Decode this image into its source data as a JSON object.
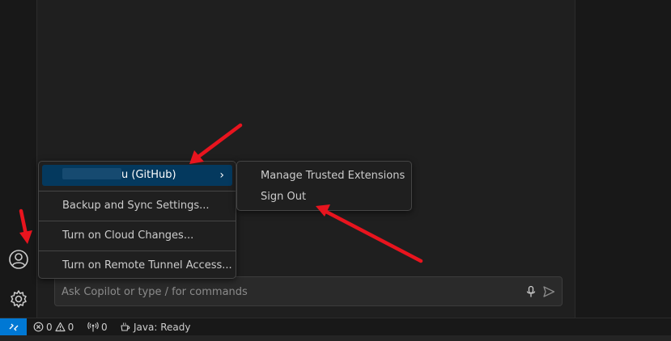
{
  "chat": {
    "placeholder": "Ask Copilot or type / for commands"
  },
  "accounts_menu": {
    "account_suffix": "u (GitHub)",
    "items": [
      "Backup and Sync Settings...",
      "Turn on Cloud Changes...",
      "Turn on Remote Tunnel Access..."
    ]
  },
  "account_submenu": {
    "items": [
      "Manage Trusted Extensions",
      "Sign Out"
    ]
  },
  "status_bar": {
    "errors": "0",
    "warnings": "0",
    "ports": "0",
    "java": "Java: Ready"
  },
  "colors": {
    "accent": "#0078d4",
    "menu_highlight": "#04395e",
    "annotation_arrow": "#e8141e"
  }
}
